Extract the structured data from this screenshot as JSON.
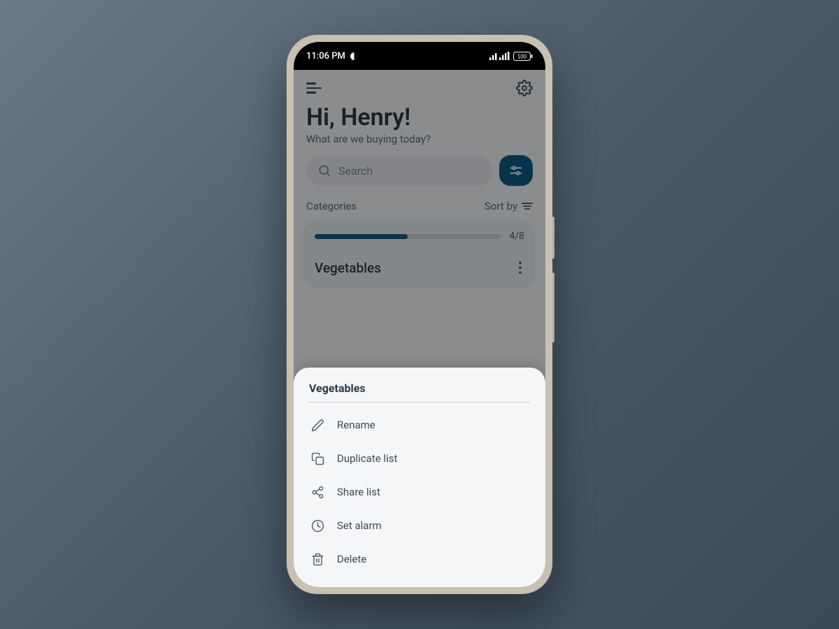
{
  "status": {
    "time": "11:06 PM",
    "battery": "100"
  },
  "header": {
    "greeting": "Hi, Henry!",
    "subtitle": "What are we buying today?"
  },
  "search": {
    "placeholder": "Search"
  },
  "section": {
    "title": "Categories",
    "sort_label": "Sort by"
  },
  "category": {
    "progress_label": "4/8",
    "progress_percent": 50,
    "name": "Vegetables"
  },
  "sheet": {
    "title": "Vegetables",
    "items": [
      {
        "icon": "pencil-icon",
        "label": "Rename"
      },
      {
        "icon": "copy-icon",
        "label": "Duplicate list"
      },
      {
        "icon": "share-icon",
        "label": "Share list"
      },
      {
        "icon": "clock-icon",
        "label": "Set alarm"
      },
      {
        "icon": "trash-icon",
        "label": "Delete"
      }
    ]
  }
}
